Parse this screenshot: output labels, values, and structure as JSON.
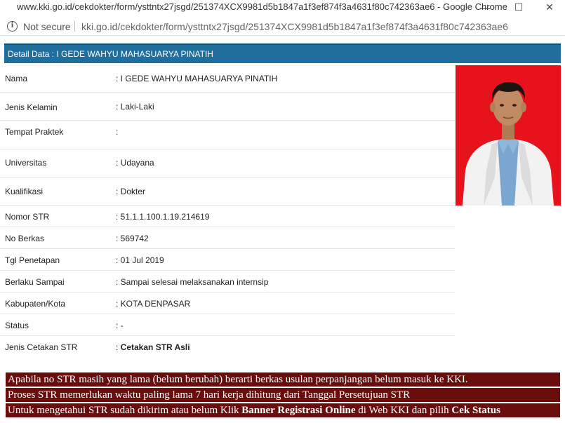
{
  "window": {
    "title": "www.kki.go.id/cekdokter/form/ysttntx27jsgd/251374XCX9981d5b1847a1f3ef874f3a4631f80c742363ae6 - Google Chrome",
    "minimize": "—",
    "maximize": "☐",
    "close": "✕"
  },
  "address_bar": {
    "info_glyph": "i",
    "security_text": "Not secure",
    "url": "kki.go.id/cekdokter/form/ysttntx27jsgd/251374XCX9981d5b1847a1f3ef874f3a4631f80c742363ae6"
  },
  "detail": {
    "header": "Detail Data : I GEDE WAHYU MAHASUARYA PINATIH",
    "fields": [
      {
        "label": "Nama",
        "value": ": I GEDE WAHYU MAHASUARYA PINATIH"
      },
      {
        "label": "Jenis Kelamin",
        "value": ": Laki-Laki"
      },
      {
        "label": "Tempat Praktek",
        "value": ":"
      },
      {
        "label": "Universitas",
        "value": ": Udayana"
      },
      {
        "label": "Kualifikasi",
        "value": ": Dokter"
      },
      {
        "label": "Nomor STR",
        "value": ": 51.1.1.100.1.19.214619"
      },
      {
        "label": "No Berkas",
        "value": ": 569742"
      },
      {
        "label": "Tgl Penetapan",
        "value": ": 01 Jul 2019"
      },
      {
        "label": "Berlaku Sampai",
        "value": ": Sampai selesai melaksanakan internsip"
      },
      {
        "label": "Kabupaten/Kota",
        "value": ": KOTA DENPASAR"
      },
      {
        "label": "Status",
        "value": ": -"
      },
      {
        "label": "Jenis Cetakan STR",
        "value_prefix": ": ",
        "value": "Cetakan STR Asli"
      }
    ]
  },
  "notices": {
    "line1": "Apabila no STR masih yang lama (belum berubah) berarti berkas usulan perpanjangan belum masuk ke KKI.",
    "line2": "Proses STR memerlukan waktu paling lama 7 hari kerja dihitung dari Tanggal Persetujuan STR",
    "line3_part1": "Untuk mengetahui STR sudah dikirim atau belum Klik ",
    "line3_bold1": "Banner Registrasi Online",
    "line3_part2": " di Web KKI dan pilih ",
    "line3_bold2": "Cek Status"
  },
  "colors": {
    "header_bg": "#1f6e9e",
    "notice_bg": "#6a0d0d",
    "photo_bg": "#e6121c"
  }
}
